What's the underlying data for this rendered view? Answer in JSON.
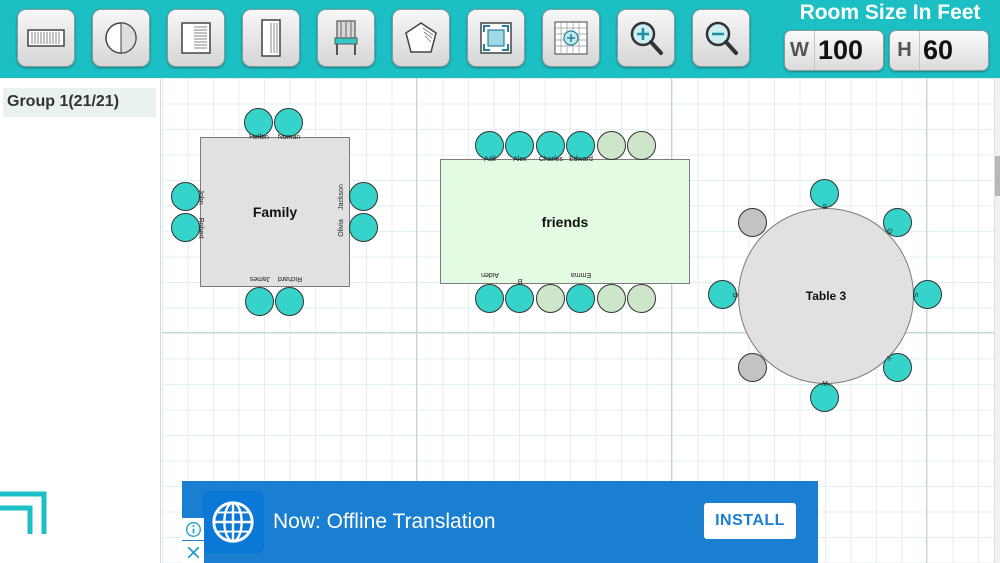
{
  "toolbar": {
    "tools": [
      {
        "name": "rectangle-table-tool",
        "icon": "rect-table-icon"
      },
      {
        "name": "round-table-tool",
        "icon": "round-table-icon"
      },
      {
        "name": "square-table-tool",
        "icon": "square-table-icon"
      },
      {
        "name": "long-table-tool",
        "icon": "long-table-icon"
      },
      {
        "name": "chair-tool",
        "icon": "chair-icon"
      },
      {
        "name": "pentagon-table-tool",
        "icon": "pentagon-icon"
      },
      {
        "name": "fit-screen-tool",
        "icon": "fit-screen-icon"
      },
      {
        "name": "grid-tool",
        "icon": "grid-icon"
      },
      {
        "name": "zoom-in-tool",
        "icon": "zoom-in-icon"
      },
      {
        "name": "zoom-out-tool",
        "icon": "zoom-out-icon"
      }
    ],
    "accent_color": "#1bbfc4"
  },
  "room": {
    "title": "Room Size In Feet",
    "width_label": "W",
    "width_value": "100",
    "height_label": "H",
    "height_value": "60"
  },
  "sidebar": {
    "groups": [
      {
        "label": "Group 1(21/21)"
      }
    ]
  },
  "tables": {
    "family": {
      "name": "Family",
      "seats": {
        "top": [
          "Hellen",
          "Noman"
        ],
        "left": [
          "John",
          "Robert"
        ],
        "right": [
          "Jackson",
          "Olivia"
        ],
        "bottom": [
          "James",
          "Richard"
        ]
      }
    },
    "friends": {
      "name": "friends",
      "seats": {
        "top": [
          "Adil",
          "Alex",
          "Charles",
          "Edward",
          "",
          ""
        ],
        "bottom": [
          "Aiden",
          "B",
          "",
          "Emma",
          "",
          ""
        ]
      }
    },
    "table3": {
      "name": "Table 3",
      "seat_labels": [
        "S",
        "G",
        "S",
        "Y",
        "W",
        "G"
      ]
    }
  },
  "ad": {
    "text": "Now: Offline Translation",
    "button": "INSTALL",
    "info_icon": "info-icon",
    "close_icon": "close-icon"
  }
}
